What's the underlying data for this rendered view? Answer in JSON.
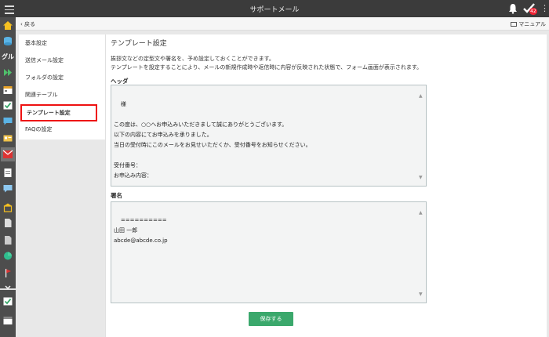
{
  "header": {
    "title": "サポートメール",
    "badge_count": "42"
  },
  "subbar": {
    "back_label": "戻る",
    "manual_label": "マニュアル"
  },
  "leftnav": {
    "group_label": "グル"
  },
  "sidenav": {
    "items": [
      {
        "label": "基本設定"
      },
      {
        "label": "送信メール設定"
      },
      {
        "label": "フォルダの設定"
      },
      {
        "label": "関連テーブル"
      },
      {
        "label": "テンプレート設定"
      },
      {
        "label": "FAQの設定"
      }
    ]
  },
  "main": {
    "title": "テンプレート設定",
    "desc1": "挨拶文などの定型文や署名を、予め設定しておくことができます。",
    "desc2": "テンプレートを設定することにより、メールの新規作成時や返信時に内容が反映された状態で、フォーム画面が表示されます。",
    "header_label": "ヘッダ",
    "header_value": "様\n\nこの度は、○○へお申込みいただきまして誠にありがとうございます。\n以下の内容にてお申込みを承りました。\n当日の受付時にこのメールをお見せいただくか、受付番号をお知らせください。\n\n受付番号：\nお申込み内容：",
    "signature_label": "署名",
    "signature_value": "==========\n山田 一郎\nabcde@abcde.co.jp",
    "save_label": "保存する"
  }
}
